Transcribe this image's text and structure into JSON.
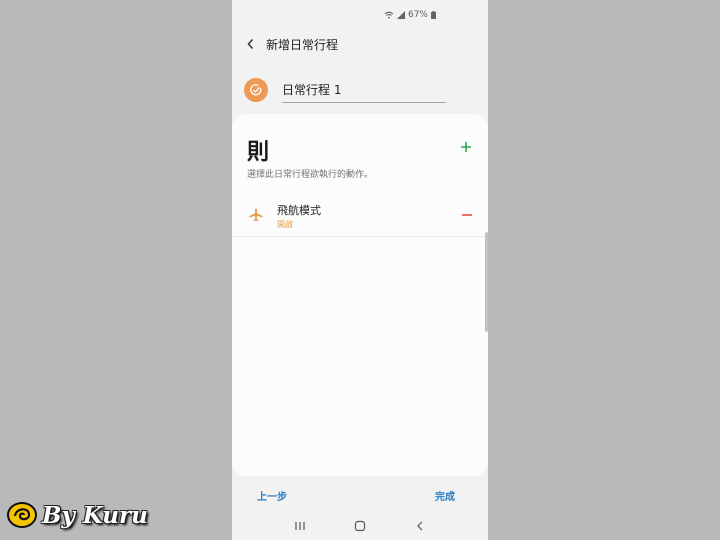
{
  "status_bar": {
    "battery": "67%"
  },
  "header": {
    "title": "新增日常行程"
  },
  "routine": {
    "name": "日常行程 1"
  },
  "then_section": {
    "heading": "則",
    "subtitle": "選擇此日常行程欲執行的動作。",
    "actions": [
      {
        "name": "飛航模式",
        "status": "開啟",
        "icon": "airplane-icon"
      }
    ]
  },
  "footer": {
    "prev_label": "上一步",
    "done_label": "完成"
  },
  "watermark": {
    "text": "By Kuru"
  },
  "colors": {
    "accent_orange": "#ee9a55",
    "plus_green": "#2fa84f",
    "minus_red": "#e0533f",
    "link_blue": "#2b7bbf"
  }
}
